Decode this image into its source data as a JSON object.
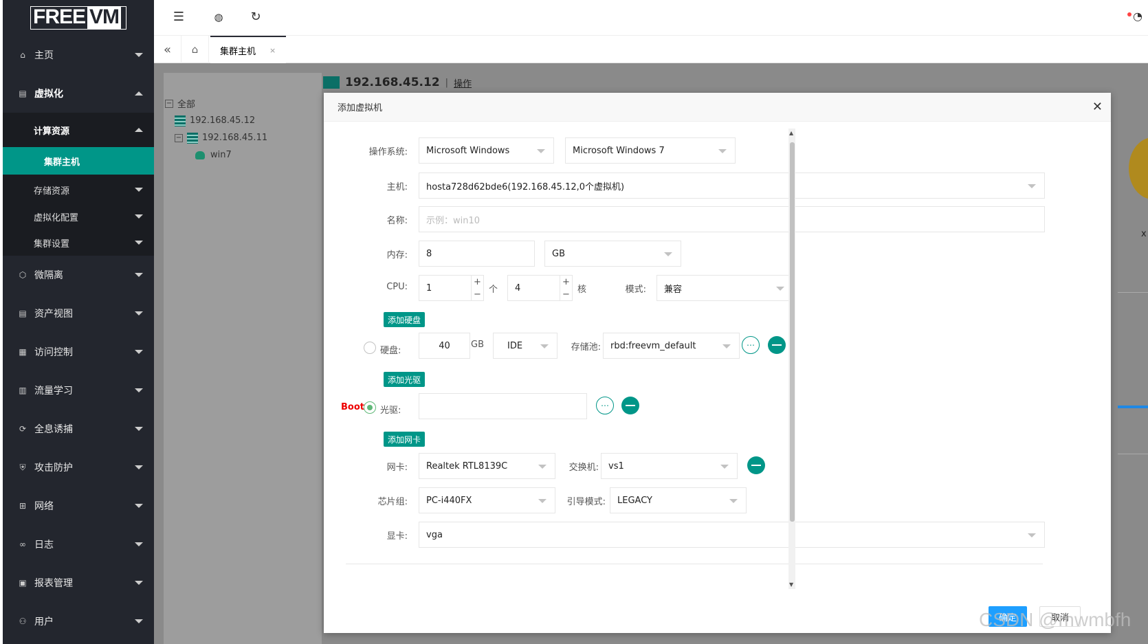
{
  "logo": {
    "part1": "FREE",
    "part2": "VM"
  },
  "sidebar": {
    "items": [
      {
        "label": "主页",
        "icon": "home-icon"
      },
      {
        "label": "虚拟化",
        "icon": "virtualization-icon"
      },
      {
        "label": "微隔离",
        "icon": "micro-isolation-icon"
      },
      {
        "label": "资产视图",
        "icon": "asset-view-icon"
      },
      {
        "label": "访问控制",
        "icon": "access-control-icon"
      },
      {
        "label": "流量学习",
        "icon": "traffic-learning-icon"
      },
      {
        "label": "全息诱捕",
        "icon": "honeypot-icon"
      },
      {
        "label": "攻击防护",
        "icon": "attack-defense-icon"
      },
      {
        "label": "网络",
        "icon": "network-icon"
      },
      {
        "label": "日志",
        "icon": "log-icon"
      },
      {
        "label": "报表管理",
        "icon": "report-icon"
      },
      {
        "label": "用户",
        "icon": "user-icon"
      }
    ],
    "sub": {
      "compute": "计算资源",
      "cluster_host": "集群主机",
      "storage": "存储资源",
      "virt_config": "虚拟化配置",
      "cluster_settings": "集群设置"
    }
  },
  "topbar": {
    "menu_icon": "menu-toggle-icon",
    "globe_icon": "globe-icon",
    "refresh_icon": "refresh-icon",
    "theme_icon": "palette-icon"
  },
  "tabs": {
    "current": "集群主机",
    "close": "×"
  },
  "tree": {
    "root": "全部",
    "node1": "192.168.45.12",
    "node2": "192.168.45.11",
    "vm": "win7"
  },
  "background": {
    "ip": "192.168.45.12",
    "sep": "|",
    "operation": "操作",
    "x": "x"
  },
  "modal": {
    "title": "添加虚拟机",
    "close": "✕",
    "os_label": "操作系统:",
    "os_family": "Microsoft Windows",
    "os_version": "Microsoft Windows 7",
    "host_label": "主机:",
    "host_value": "hosta728d62bde6(192.168.45.12,0个虚拟机)",
    "name_label": "名称:",
    "name_placeholder": "示例：win10",
    "memory_label": "内存:",
    "memory_value": "8",
    "memory_unit": "GB",
    "cpu_label": "CPU:",
    "cpu_count": "1",
    "cpu_count_unit": "个",
    "cpu_cores": "4",
    "cpu_cores_unit": "核",
    "mode_label": "模式:",
    "mode_value": "兼容",
    "add_disk": "添加硬盘",
    "disk_label": "硬盘:",
    "disk_size": "40",
    "disk_unit": "GB",
    "disk_bus": "IDE",
    "pool_label": "存储池:",
    "pool_value": "rbd:freevm_default",
    "add_cdrom": "添加光驱",
    "boot_label": "Boot",
    "cdrom_label": "光驱:",
    "cdrom_value": "",
    "add_nic": "添加网卡",
    "nic_label": "网卡:",
    "nic_value": "Realtek RTL8139C",
    "switch_label": "交换机:",
    "switch_value": "vs1",
    "chipset_label": "芯片组:",
    "chipset_value": "PC-i440FX",
    "boot_mode_label": "引导模式:",
    "boot_mode_value": "LEGACY",
    "gpu_label": "显卡:",
    "gpu_value": "vga",
    "ok": "确定",
    "cancel": "取消"
  },
  "watermark": "CSDN @mwmbfh"
}
